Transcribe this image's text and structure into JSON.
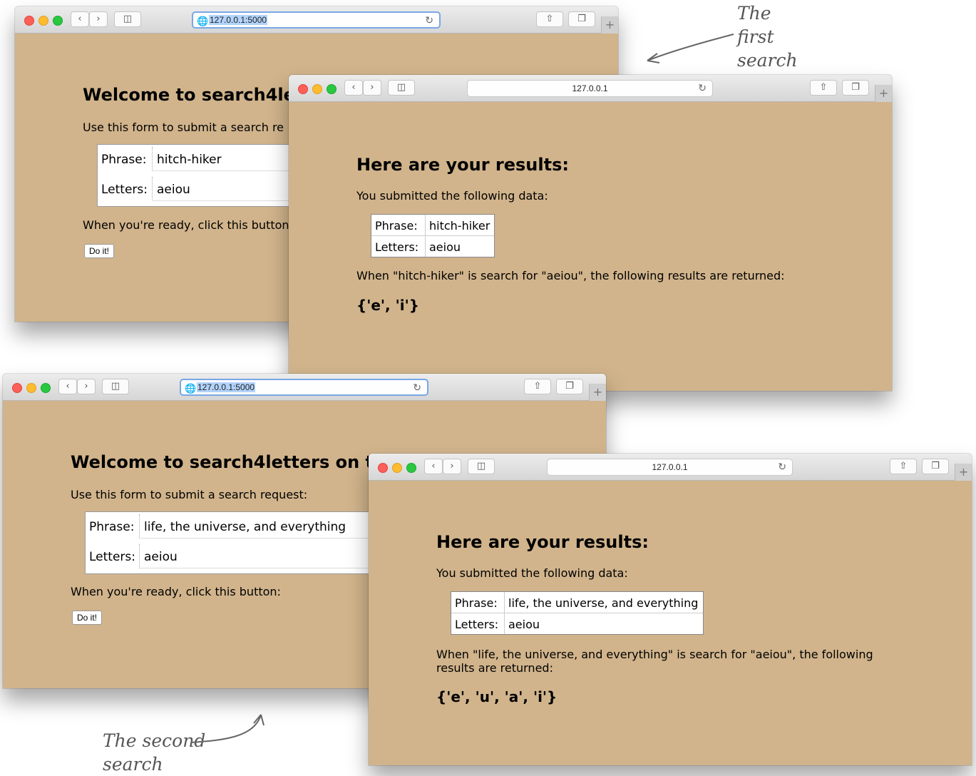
{
  "annotations": {
    "first": [
      "The",
      "first",
      "search"
    ],
    "second": [
      "The second",
      "search"
    ]
  },
  "windows": {
    "form1": {
      "url": "127.0.0.1:5000",
      "heading": "Welcome to search4le",
      "intro": "Use this form to submit a search re",
      "phrase_label": "Phrase:",
      "phrase_value": "hitch-hiker",
      "letters_label": "Letters:",
      "letters_value": "aeiou",
      "ready_text": "When you're ready, click this button",
      "button_label": "Do it!"
    },
    "result1": {
      "url": "127.0.0.1",
      "heading": "Here are your results:",
      "intro": "You submitted the following data:",
      "phrase_label": "Phrase:",
      "phrase_value": "hitch-hiker",
      "letters_label": "Letters:",
      "letters_value": "aeiou",
      "summary": "When \"hitch-hiker\" is search for \"aeiou\", the following results are returned:",
      "result": "{'e', 'i'}"
    },
    "form2": {
      "url": "127.0.0.1:5000",
      "heading": "Welcome to search4letters on t",
      "intro": "Use this form to submit a search request:",
      "phrase_label": "Phrase:",
      "phrase_value": "life, the universe, and everything",
      "letters_label": "Letters:",
      "letters_value": "aeiou",
      "ready_text": "When you're ready, click this button:",
      "button_label": "Do it!"
    },
    "result2": {
      "url": "127.0.0.1",
      "heading": "Here are your results:",
      "intro": "You submitted the following data:",
      "phrase_label": "Phrase:",
      "phrase_value": "life, the universe, and everything",
      "letters_label": "Letters:",
      "letters_value": "aeiou",
      "summary_line1": "When \"life, the universe, and everything\" is search for \"aeiou\", the following",
      "summary_line2": "results are returned:",
      "result": "{'e', 'u', 'a', 'i'}"
    }
  },
  "colors": {
    "page_background": "#d1b48c",
    "address_selection": "#b2d3fb"
  }
}
